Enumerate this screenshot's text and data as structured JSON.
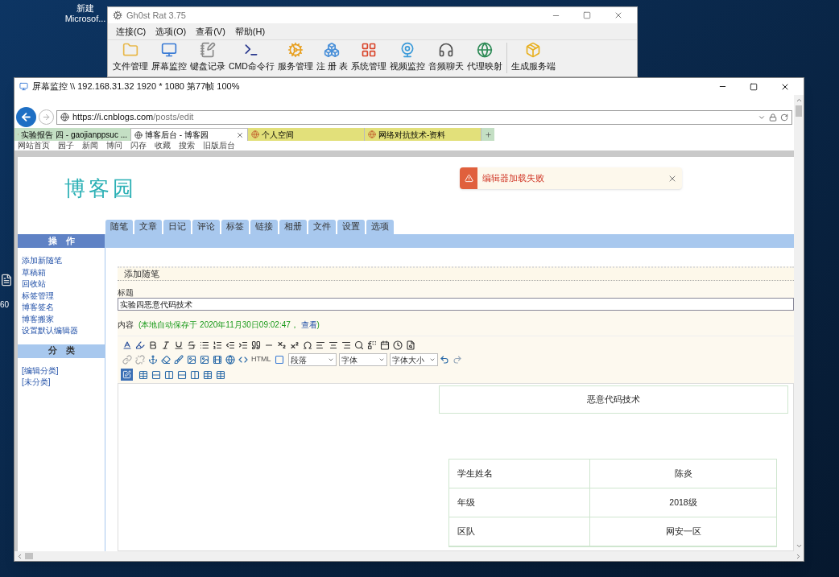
{
  "desktop": {
    "icon_label": [
      "新建",
      "Microsof..."
    ],
    "edge_label": "60"
  },
  "ghost_window": {
    "title": "Gh0st Rat 3.75",
    "menu": [
      "连接(C)",
      "选项(O)",
      "查看(V)",
      "帮助(H)"
    ],
    "toolbar": [
      {
        "label": "文件管理"
      },
      {
        "label": "屏幕监控"
      },
      {
        "label": "键盘记录"
      },
      {
        "label": "CMD命令行"
      },
      {
        "label": "服务管理"
      },
      {
        "label": "注 册 表"
      },
      {
        "label": "系统管理"
      },
      {
        "label": "视频监控"
      },
      {
        "label": "音频聊天"
      },
      {
        "label": "代理映射"
      },
      {
        "label": "生成服务端"
      }
    ]
  },
  "monitor_window": {
    "title": "屏幕监控 \\\\ 192.168.31.32 1920 * 1080 第77帧 100%",
    "browser": {
      "address_host": "https://i.cnblogs.com",
      "address_path": "/posts/edit",
      "tabs": [
        {
          "label": "实验报告 四 - gaojianppsuc ...",
          "selected": false,
          "color": "#c4dfc4"
        },
        {
          "label": "博客后台 - 博客园",
          "selected": true,
          "color": "#ffffff"
        },
        {
          "label": "个人空间",
          "selected": false,
          "color": "#e2e07a"
        },
        {
          "label": "网络对抗技术-资料",
          "selected": false,
          "color": "#e2e07a"
        }
      ],
      "nav_links": [
        "网站首页",
        "园子",
        "新闻",
        "博问",
        "闪存",
        "收藏",
        "搜索",
        "旧版后台"
      ]
    },
    "page": {
      "logo": "博客园",
      "toast": {
        "message": "编辑器加载失败"
      },
      "tabs": [
        "随笔",
        "文章",
        "日记",
        "评论",
        "标签",
        "链接",
        "相册",
        "文件",
        "设置",
        "选项"
      ],
      "sidebar": [
        {
          "title": "操　作",
          "kind": "primary",
          "links": [
            "添加新随笔",
            "草稿箱",
            "回收站",
            "标签管理",
            "博客签名",
            "博客搬家",
            "设置默认编辑器"
          ]
        },
        {
          "title": "分　类",
          "kind": "secondary",
          "links": [
            "[编辑分类]",
            "[未分类]"
          ]
        }
      ],
      "form": {
        "section_title": "添加随笔",
        "title_label": "标题",
        "title_value": "实验四恶意代码技术",
        "content_label": "内容",
        "autosave": {
          "text": "(本地自动保存于 2020年11月30日09:02:47，",
          "link": "查看",
          "suffix": ")"
        },
        "toolbar": {
          "html_label": "HTML",
          "selects": [
            "段落",
            "字体",
            "字体大小"
          ]
        },
        "editor": {
          "heading_box": "恶意代码技术",
          "table": [
            {
              "label": "学生姓名",
              "value": "陈炎"
            },
            {
              "label": "年级",
              "value": "2018级"
            },
            {
              "label": "区队",
              "value": "网安一区"
            }
          ]
        }
      }
    }
  }
}
